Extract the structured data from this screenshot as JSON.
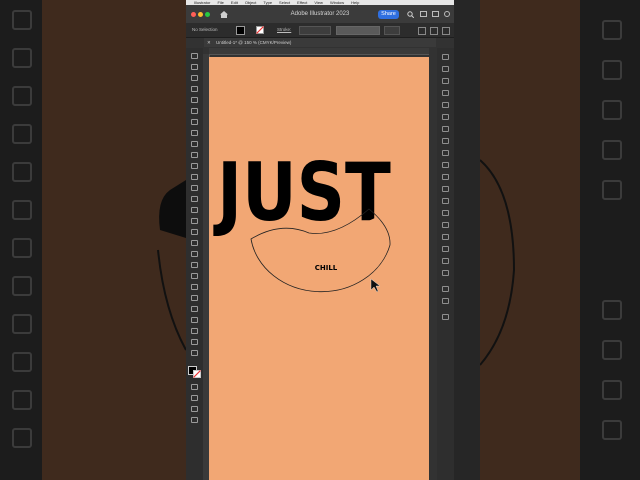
{
  "app": {
    "title": "Adobe Illustrator 2023",
    "share_label": "Share",
    "menu": [
      "Illustrator",
      "File",
      "Edit",
      "Object",
      "Type",
      "Select",
      "Effect",
      "View",
      "Window",
      "Help"
    ]
  },
  "controlbar": {
    "selection": "No Selection",
    "stroke_label": "Stroke:"
  },
  "document": {
    "tab": "Untitled-1* @ 150 % (CMYK/Preview)"
  },
  "artwork": {
    "headline": "JUST",
    "subtext": "CHILL"
  },
  "colors": {
    "artboard": "#f2a774",
    "app_bg": "#323232",
    "share_button": "#2f6fe0",
    "backdrop": "#3f2a1d"
  }
}
